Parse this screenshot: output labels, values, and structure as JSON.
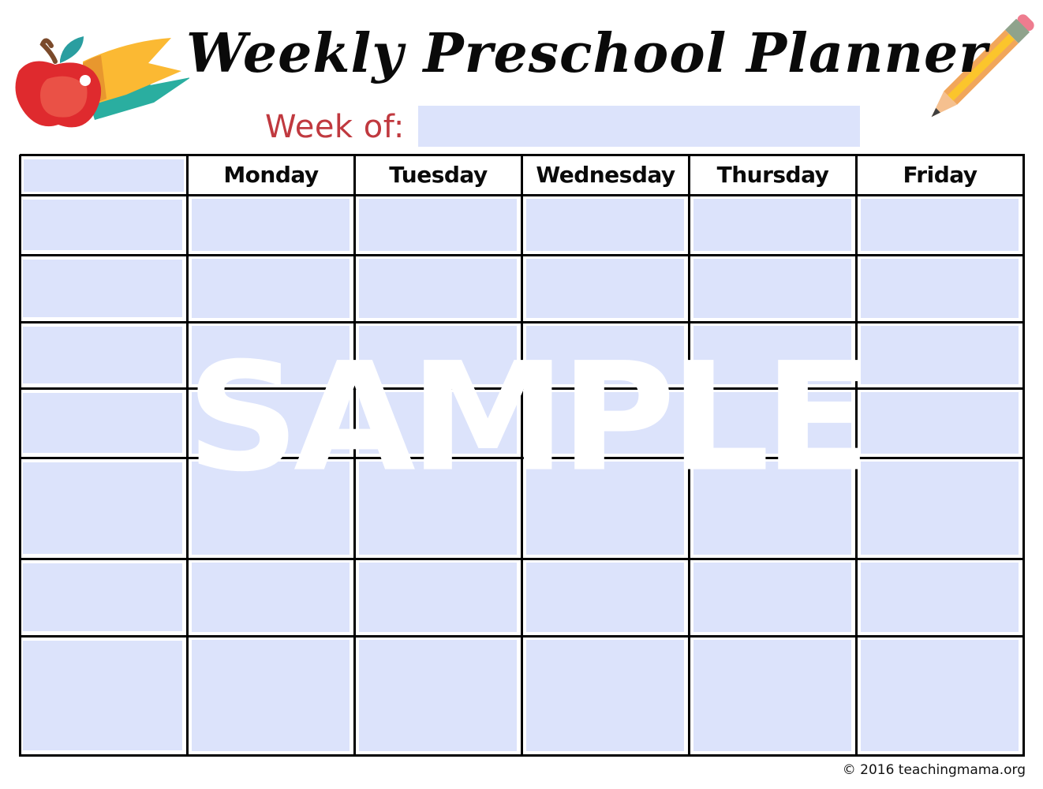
{
  "header": {
    "title": "Weekly Preschool Planner",
    "week_of_label": "Week of:",
    "week_of_value": "",
    "icons": [
      "apple-icon",
      "ribbon-icon",
      "pencil-icon"
    ]
  },
  "table": {
    "corner_cell_value": "",
    "days": [
      "Monday",
      "Tuesday",
      "Wednesday",
      "Thursday",
      "Friday"
    ],
    "row_count": 7,
    "rows": [
      {
        "label": "",
        "cells": [
          "",
          "",
          "",
          "",
          ""
        ]
      },
      {
        "label": "",
        "cells": [
          "",
          "",
          "",
          "",
          ""
        ]
      },
      {
        "label": "",
        "cells": [
          "",
          "",
          "",
          "",
          ""
        ]
      },
      {
        "label": "",
        "cells": [
          "",
          "",
          "",
          "",
          ""
        ]
      },
      {
        "label": "",
        "cells": [
          "",
          "",
          "",
          "",
          ""
        ]
      },
      {
        "label": "",
        "cells": [
          "",
          "",
          "",
          "",
          ""
        ]
      },
      {
        "label": "",
        "cells": [
          "",
          "",
          "",
          "",
          ""
        ]
      }
    ]
  },
  "watermark": "SAMPLE",
  "footer": "© 2016 teachingmama.org",
  "colors": {
    "field_fill": "#dce3fb",
    "week_of_label": "#c0393f",
    "grid_line": "#000000"
  }
}
